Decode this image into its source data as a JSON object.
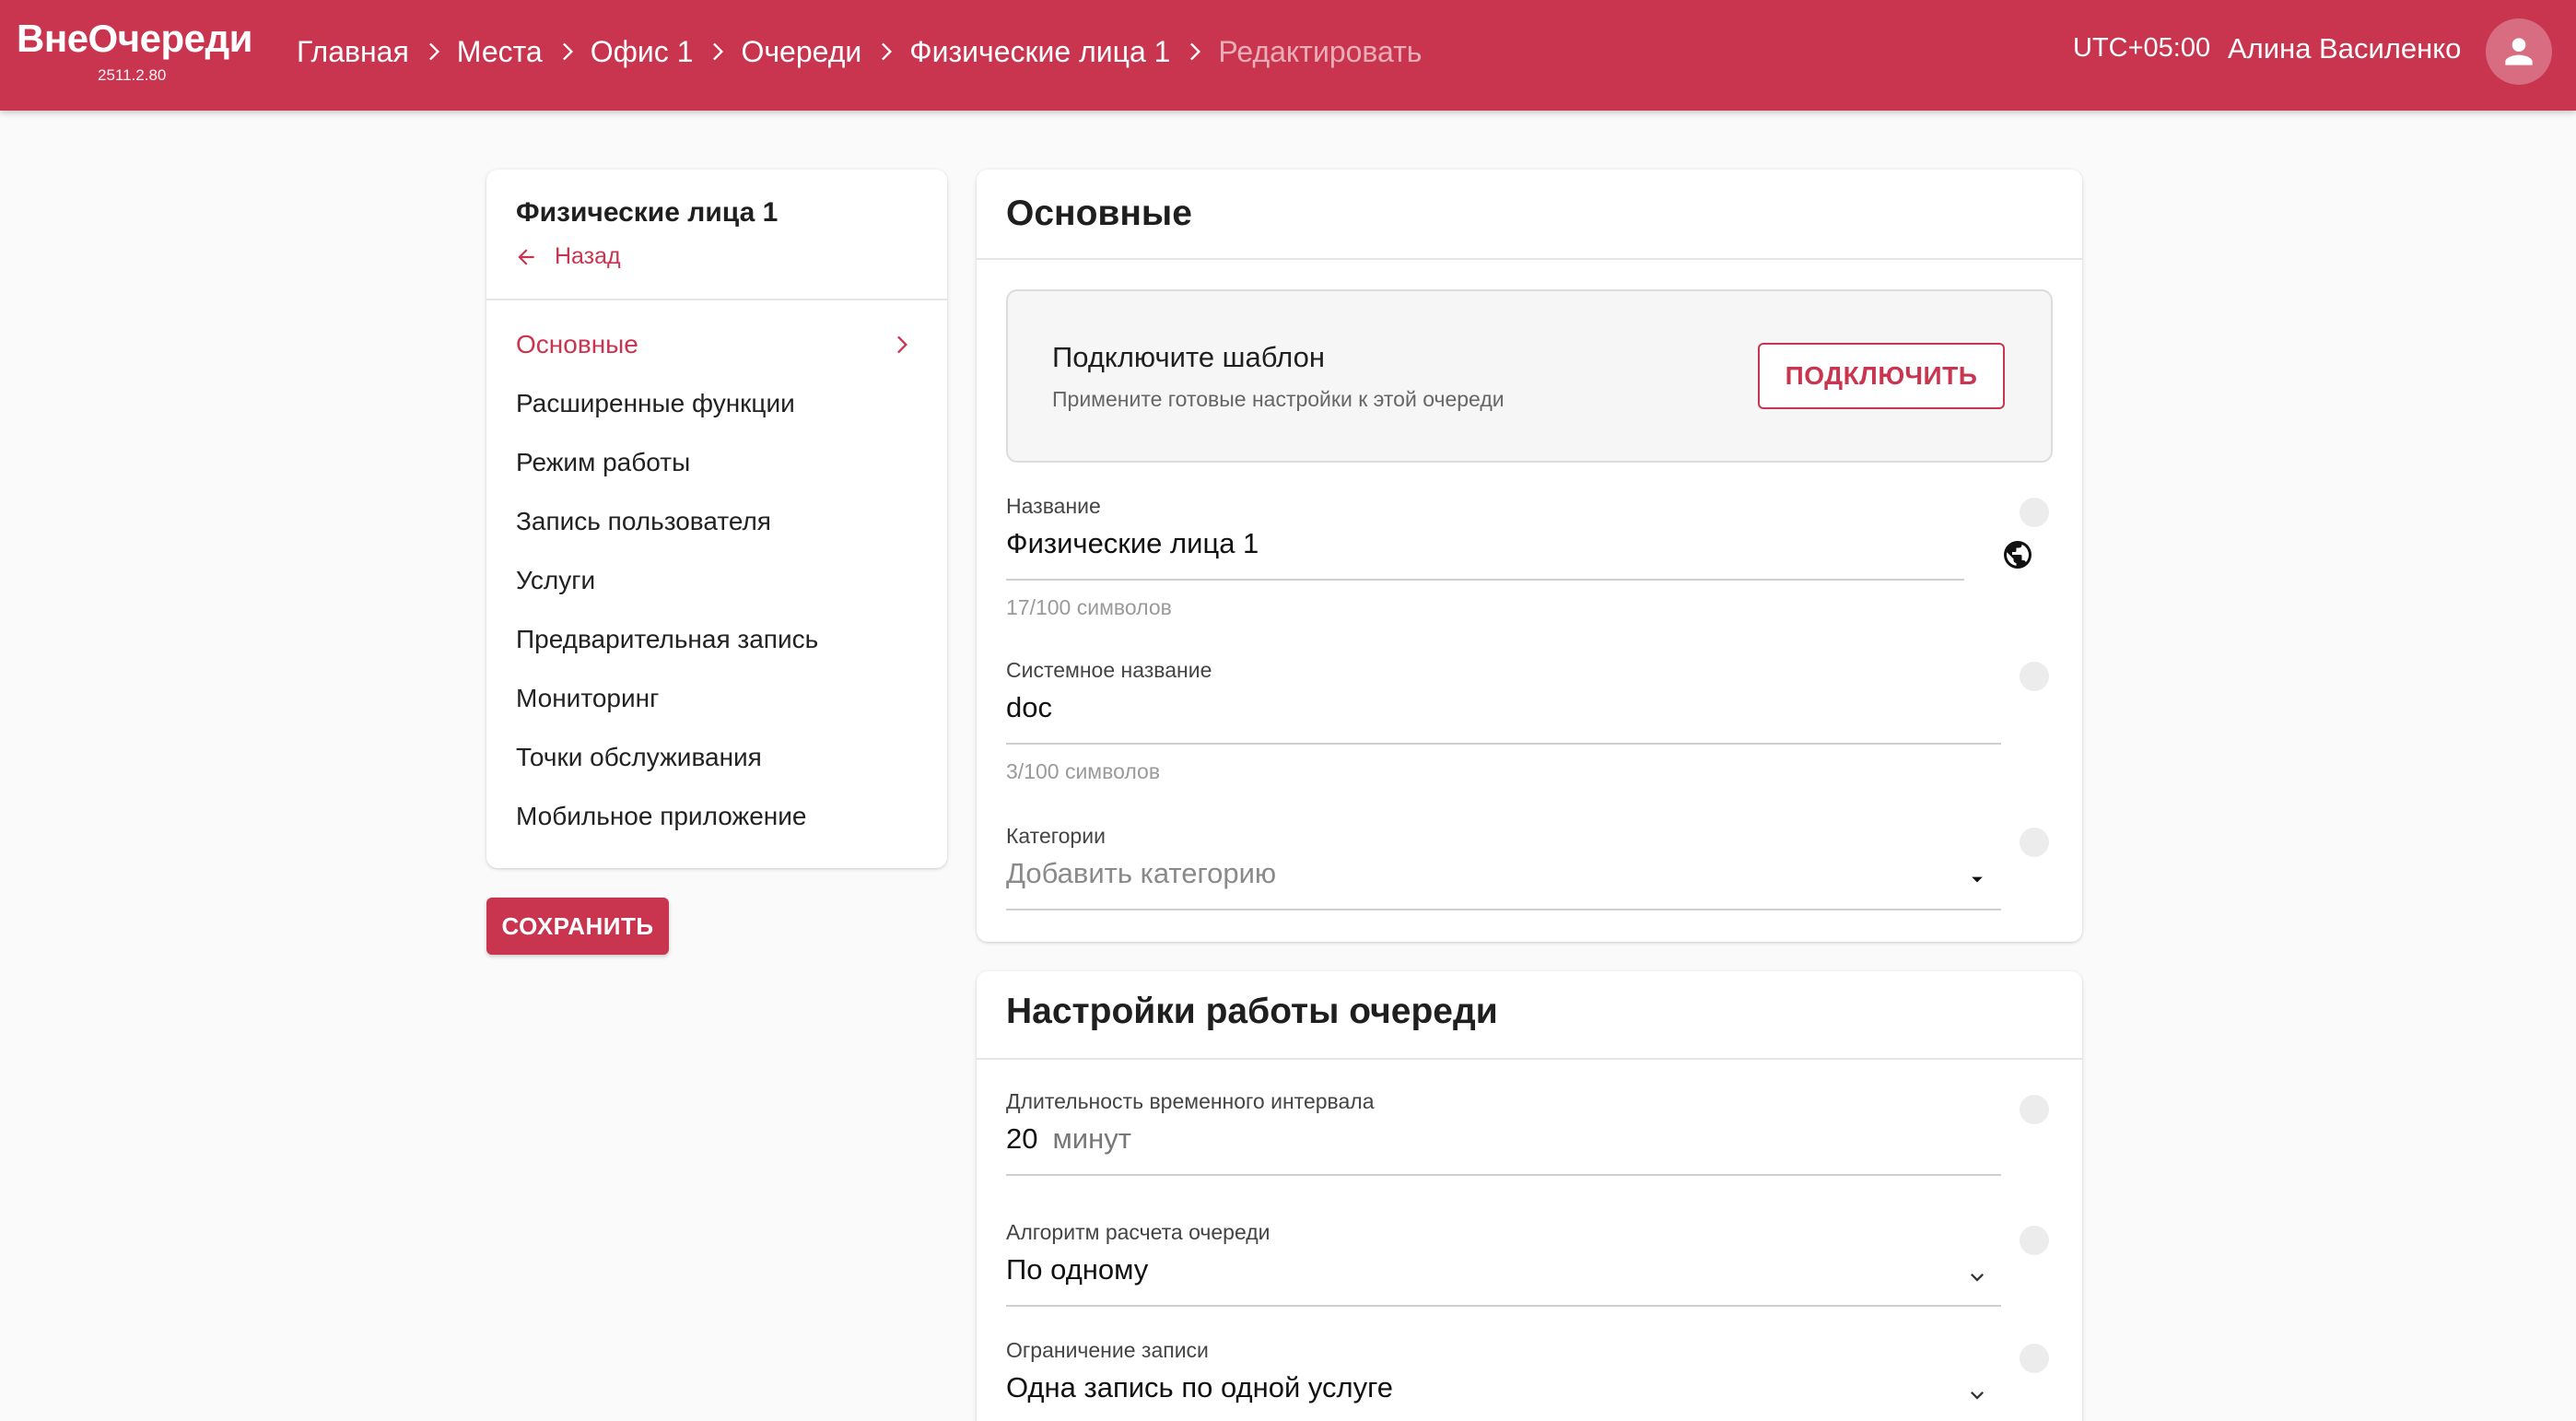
{
  "colors": {
    "accent": "#c9344f"
  },
  "header": {
    "logo": "ВнеОчереди",
    "version": "2511.2.80",
    "breadcrumbs": [
      "Главная",
      "Места",
      "Офис 1",
      "Очереди",
      "Физические лица 1"
    ],
    "breadcrumb_current": "Редактировать",
    "timezone": "UTC+05:00",
    "user_name": "Алина Василенко",
    "avatar_icon": "account-icon"
  },
  "sidebar": {
    "title": "Физические лица 1",
    "back_label": "Назад",
    "items": [
      {
        "label": "Основные",
        "active": true
      },
      {
        "label": "Расширенные функции"
      },
      {
        "label": "Режим работы"
      },
      {
        "label": "Запись пользователя"
      },
      {
        "label": "Услуги"
      },
      {
        "label": "Предварительная запись"
      },
      {
        "label": "Мониторинг"
      },
      {
        "label": "Точки обслуживания"
      },
      {
        "label": "Мобильное приложение"
      }
    ],
    "save_label": "СОХРАНИТЬ"
  },
  "basic": {
    "title": "Основные",
    "template": {
      "title": "Подключите шаблон",
      "description": "Примените готовые настройки к этой очереди",
      "button": "ПОДКЛЮЧИТЬ"
    },
    "name": {
      "label": "Название",
      "value": "Физические лица 1",
      "hint": "17/100 символов"
    },
    "system_name": {
      "label": "Системное название",
      "value": "doc",
      "hint": "3/100 символов"
    },
    "categories": {
      "label": "Категории",
      "placeholder": "Добавить категорию"
    }
  },
  "queue_settings": {
    "title": "Настройки работы очереди",
    "interval": {
      "label": "Длительность временного интервала",
      "value": "20",
      "unit": "минут"
    },
    "algorithm": {
      "label": "Алгоритм расчета очереди",
      "value": "По одному"
    },
    "limit": {
      "label": "Ограничение записи",
      "value": "Одна запись по одной услуге"
    }
  }
}
